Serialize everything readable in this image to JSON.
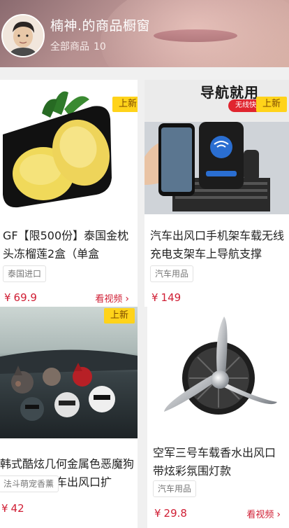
{
  "header": {
    "shop_title": "楠神.的商品橱窗",
    "subtitle_label": "全部商品",
    "product_count": "10"
  },
  "badges": {
    "new": "上新"
  },
  "products": [
    {
      "title": "GF【限500份】泰国金枕头冻榴莲2盒（单盒",
      "tag": "泰国进口",
      "price": "69.9",
      "currency": "¥",
      "video_label": "看视频",
      "has_new_badge": true
    },
    {
      "title": "汽车出风口手机架车载无线充电支架车上导航支撑",
      "tag": "汽车用品",
      "price": "149",
      "currency": "¥",
      "video_label": "",
      "has_new_badge": true,
      "image_text": {
        "headline": "导航就用",
        "sticker": "无线快速充电"
      }
    },
    {
      "title": "韩式酷炫几何金属色恶魔狗法斗牛犬汽车出风口扩",
      "tag": "法斗萌宠香薰",
      "price": "42",
      "currency": "¥",
      "video_label": "",
      "has_new_badge": true
    },
    {
      "title": "空军三号车载香水出风口带炫彩氛围灯款",
      "tag": "汽车用品",
      "price": "29.8",
      "currency": "¥",
      "video_label": "看视频",
      "has_new_badge": false
    }
  ],
  "colors": {
    "price": "#d01e34",
    "badge": "#ffd31a",
    "background": "#f0f0f0"
  }
}
